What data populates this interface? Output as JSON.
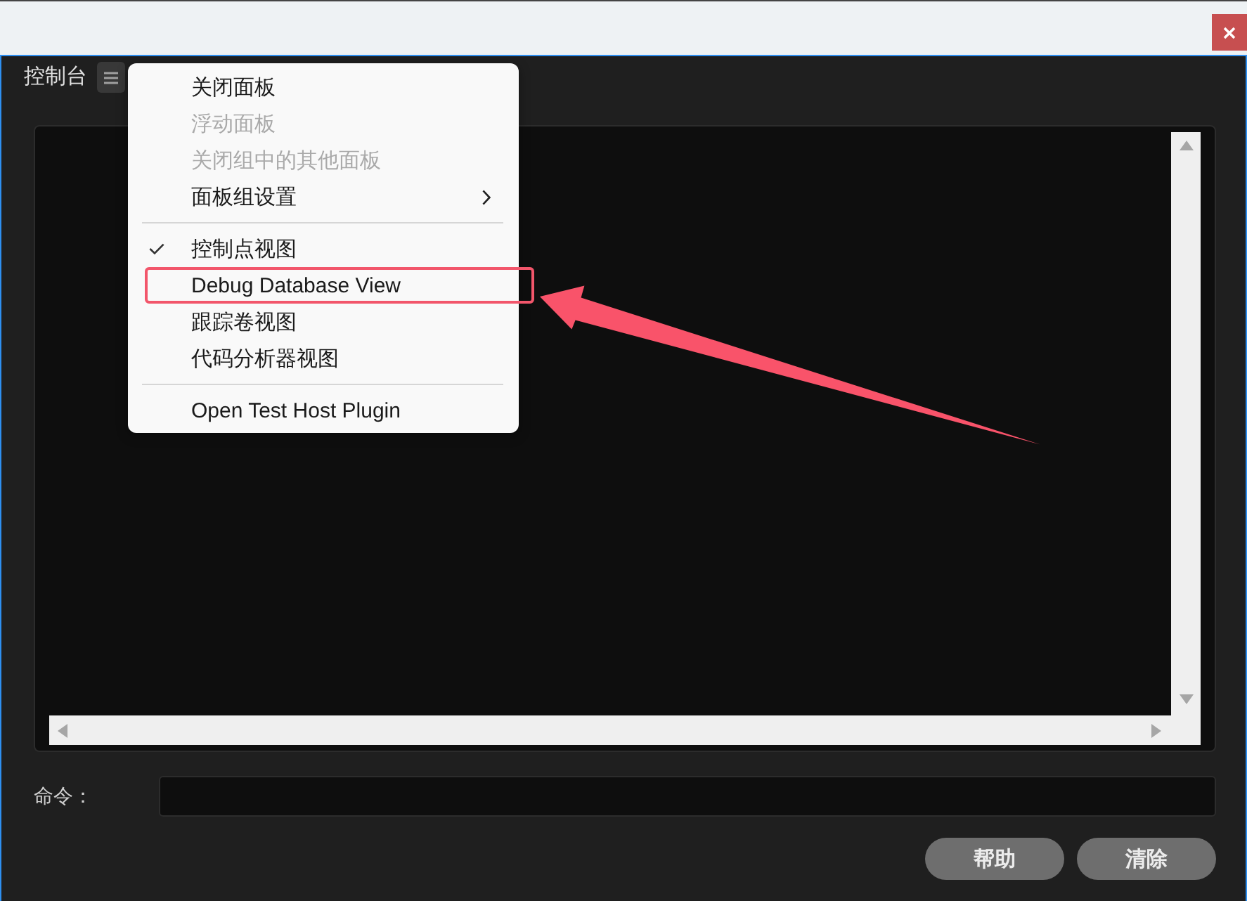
{
  "panel": {
    "title": "控制台"
  },
  "menu": {
    "groups": [
      [
        {
          "label": "关闭面板",
          "disabled": false,
          "checked": false,
          "submenu": false,
          "highlighted": false
        },
        {
          "label": "浮动面板",
          "disabled": true,
          "checked": false,
          "submenu": false,
          "highlighted": false
        },
        {
          "label": "关闭组中的其他面板",
          "disabled": true,
          "checked": false,
          "submenu": false,
          "highlighted": false
        },
        {
          "label": "面板组设置",
          "disabled": false,
          "checked": false,
          "submenu": true,
          "highlighted": false
        }
      ],
      [
        {
          "label": "控制点视图",
          "disabled": false,
          "checked": true,
          "submenu": false,
          "highlighted": false
        },
        {
          "label": "Debug Database View",
          "disabled": false,
          "checked": false,
          "submenu": false,
          "highlighted": true
        },
        {
          "label": "跟踪卷视图",
          "disabled": false,
          "checked": false,
          "submenu": false,
          "highlighted": false
        },
        {
          "label": "代码分析器视图",
          "disabled": false,
          "checked": false,
          "submenu": false,
          "highlighted": false
        }
      ],
      [
        {
          "label": "Open Test Host Plugin",
          "disabled": false,
          "checked": false,
          "submenu": false,
          "highlighted": false
        }
      ]
    ]
  },
  "command": {
    "label": "命令："
  },
  "buttons": [
    "帮助",
    "清除"
  ]
}
